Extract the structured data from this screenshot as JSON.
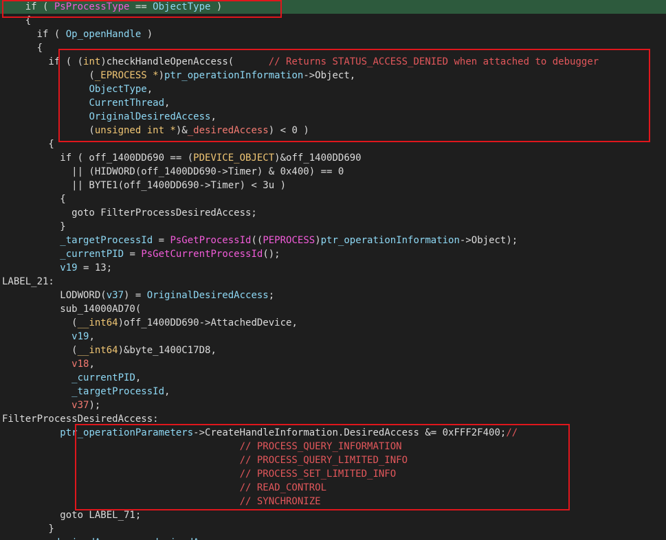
{
  "editor": {
    "lines": [
      [
        {
          "t": "    if ( ",
          "c": "p"
        },
        {
          "t": "PsProcessType",
          "c": "x"
        },
        {
          "t": " == ",
          "c": "p"
        },
        {
          "t": "ObjectType",
          "c": "f"
        },
        {
          "t": " )",
          "c": "p"
        }
      ],
      [
        {
          "t": "    {",
          "c": "p"
        }
      ],
      [
        {
          "t": "      if ( ",
          "c": "p"
        },
        {
          "t": "Op_openHandle",
          "c": "f"
        },
        {
          "t": " )",
          "c": "p"
        }
      ],
      [
        {
          "t": "      {",
          "c": "p"
        }
      ],
      [
        {
          "t": "        if ( (",
          "c": "p"
        },
        {
          "t": "int",
          "c": "t"
        },
        {
          "t": ")checkHandleOpenAccess(      ",
          "c": "p"
        },
        {
          "t": "// Returns STATUS_ACCESS_DENIED when attached to debugger",
          "c": "c"
        }
      ],
      [
        {
          "t": "               (",
          "c": "p"
        },
        {
          "t": "_EPROCESS *",
          "c": "t"
        },
        {
          "t": ")",
          "c": "p"
        },
        {
          "t": "ptr_operationInformation",
          "c": "f"
        },
        {
          "t": "->Object,",
          "c": "p"
        }
      ],
      [
        {
          "t": "               ",
          "c": "p"
        },
        {
          "t": "ObjectType",
          "c": "f"
        },
        {
          "t": ",",
          "c": "p"
        }
      ],
      [
        {
          "t": "               ",
          "c": "p"
        },
        {
          "t": "CurrentThread",
          "c": "f"
        },
        {
          "t": ",",
          "c": "p"
        }
      ],
      [
        {
          "t": "               ",
          "c": "p"
        },
        {
          "t": "OriginalDesiredAccess",
          "c": "f"
        },
        {
          "t": ",",
          "c": "p"
        }
      ],
      [
        {
          "t": "               (",
          "c": "p"
        },
        {
          "t": "unsigned int *",
          "c": "t"
        },
        {
          "t": ")&",
          "c": "p"
        },
        {
          "t": "_desiredAccess",
          "c": "v"
        },
        {
          "t": ") < 0 )",
          "c": "p"
        }
      ],
      [
        {
          "t": "        {",
          "c": "p"
        }
      ],
      [
        {
          "t": "          if ( off_1400DD690 == (",
          "c": "p"
        },
        {
          "t": "PDEVICE_OBJECT",
          "c": "t"
        },
        {
          "t": ")&off_1400DD690",
          "c": "p"
        }
      ],
      [
        {
          "t": "            || (HIDWORD(off_1400DD690->Timer) & 0x400) == 0",
          "c": "p"
        }
      ],
      [
        {
          "t": "            || BYTE1(off_1400DD690->Timer) < 3u )",
          "c": "p"
        }
      ],
      [
        {
          "t": "          {",
          "c": "p"
        }
      ],
      [
        {
          "t": "            goto FilterProcessDesiredAccess;",
          "c": "p"
        }
      ],
      [
        {
          "t": "          }",
          "c": "p"
        }
      ],
      [
        {
          "t": "          ",
          "c": "p"
        },
        {
          "t": "_targetProcessId",
          "c": "f"
        },
        {
          "t": " = ",
          "c": "p"
        },
        {
          "t": "PsGetProcessId",
          "c": "x"
        },
        {
          "t": "((",
          "c": "p"
        },
        {
          "t": "PEPROCESS",
          "c": "x"
        },
        {
          "t": ")",
          "c": "p"
        },
        {
          "t": "ptr_operationInformation",
          "c": "f"
        },
        {
          "t": "->Object);",
          "c": "p"
        }
      ],
      [
        {
          "t": "          ",
          "c": "p"
        },
        {
          "t": "_currentPID",
          "c": "f"
        },
        {
          "t": " = ",
          "c": "p"
        },
        {
          "t": "PsGetCurrentProcessId",
          "c": "x"
        },
        {
          "t": "();",
          "c": "p"
        }
      ],
      [
        {
          "t": "          ",
          "c": "p"
        },
        {
          "t": "v19",
          "c": "f"
        },
        {
          "t": " = 13;",
          "c": "p"
        }
      ],
      [
        {
          "t": "LABEL_21:",
          "c": "p"
        }
      ],
      [
        {
          "t": "          LODWORD(",
          "c": "p"
        },
        {
          "t": "v37",
          "c": "f"
        },
        {
          "t": ") = ",
          "c": "p"
        },
        {
          "t": "OriginalDesiredAccess",
          "c": "f"
        },
        {
          "t": ";",
          "c": "p"
        }
      ],
      [
        {
          "t": "          sub_14000AD70(",
          "c": "p"
        }
      ],
      [
        {
          "t": "            (",
          "c": "p"
        },
        {
          "t": "__int64",
          "c": "t"
        },
        {
          "t": ")off_1400DD690->AttachedDevice,",
          "c": "p"
        }
      ],
      [
        {
          "t": "            ",
          "c": "p"
        },
        {
          "t": "v19",
          "c": "f"
        },
        {
          "t": ",",
          "c": "p"
        }
      ],
      [
        {
          "t": "            (",
          "c": "p"
        },
        {
          "t": "__int64",
          "c": "t"
        },
        {
          "t": ")&byte_1400C17D8,",
          "c": "p"
        }
      ],
      [
        {
          "t": "            ",
          "c": "p"
        },
        {
          "t": "v18",
          "c": "v"
        },
        {
          "t": ",",
          "c": "p"
        }
      ],
      [
        {
          "t": "            ",
          "c": "p"
        },
        {
          "t": "_currentPID",
          "c": "f"
        },
        {
          "t": ",",
          "c": "p"
        }
      ],
      [
        {
          "t": "            ",
          "c": "p"
        },
        {
          "t": "_targetProcessId",
          "c": "f"
        },
        {
          "t": ",",
          "c": "p"
        }
      ],
      [
        {
          "t": "            ",
          "c": "p"
        },
        {
          "t": "v37",
          "c": "v"
        },
        {
          "t": ");",
          "c": "p"
        }
      ],
      [
        {
          "t": "FilterProcessDesiredAccess:",
          "c": "p"
        }
      ],
      [
        {
          "t": "          ",
          "c": "p"
        },
        {
          "t": "ptr_operationParameters",
          "c": "f"
        },
        {
          "t": "->CreateHandleInformation.DesiredAccess &= 0xFFF2F400;",
          "c": "p"
        },
        {
          "t": "//",
          "c": "c"
        }
      ],
      [
        {
          "t": "                                         ",
          "c": "p"
        },
        {
          "t": "// PROCESS_QUERY_INFORMATION",
          "c": "c"
        }
      ],
      [
        {
          "t": "                                         ",
          "c": "p"
        },
        {
          "t": "// PROCESS_QUERY_LIMITED_INFO",
          "c": "c"
        }
      ],
      [
        {
          "t": "                                         ",
          "c": "p"
        },
        {
          "t": "// PROCESS_SET_LIMITED_INFO",
          "c": "c"
        }
      ],
      [
        {
          "t": "                                         ",
          "c": "p"
        },
        {
          "t": "// READ_CONTROL",
          "c": "c"
        }
      ],
      [
        {
          "t": "                                         ",
          "c": "p"
        },
        {
          "t": "// SYNCHRONIZE",
          "c": "c"
        }
      ],
      [
        {
          "t": "          goto LABEL_71;",
          "c": "p"
        }
      ],
      [
        {
          "t": "        }",
          "c": "p"
        }
      ],
      [
        {
          "t": "        ",
          "c": "p"
        },
        {
          "t": "_desiredAccess",
          "c": "f"
        },
        {
          "t": " = _desiredA",
          "c": "f"
        }
      ]
    ]
  },
  "colors": {
    "background": "#1e1e1e",
    "current_line": "#2d5a3d",
    "plain": "#dcdcdc",
    "identifier": "#8ed8f4",
    "type": "#f0c674",
    "variable": "#f47b72",
    "comment": "#e2575b",
    "import": "#f25cda",
    "highlight_box": "#e0161c"
  }
}
